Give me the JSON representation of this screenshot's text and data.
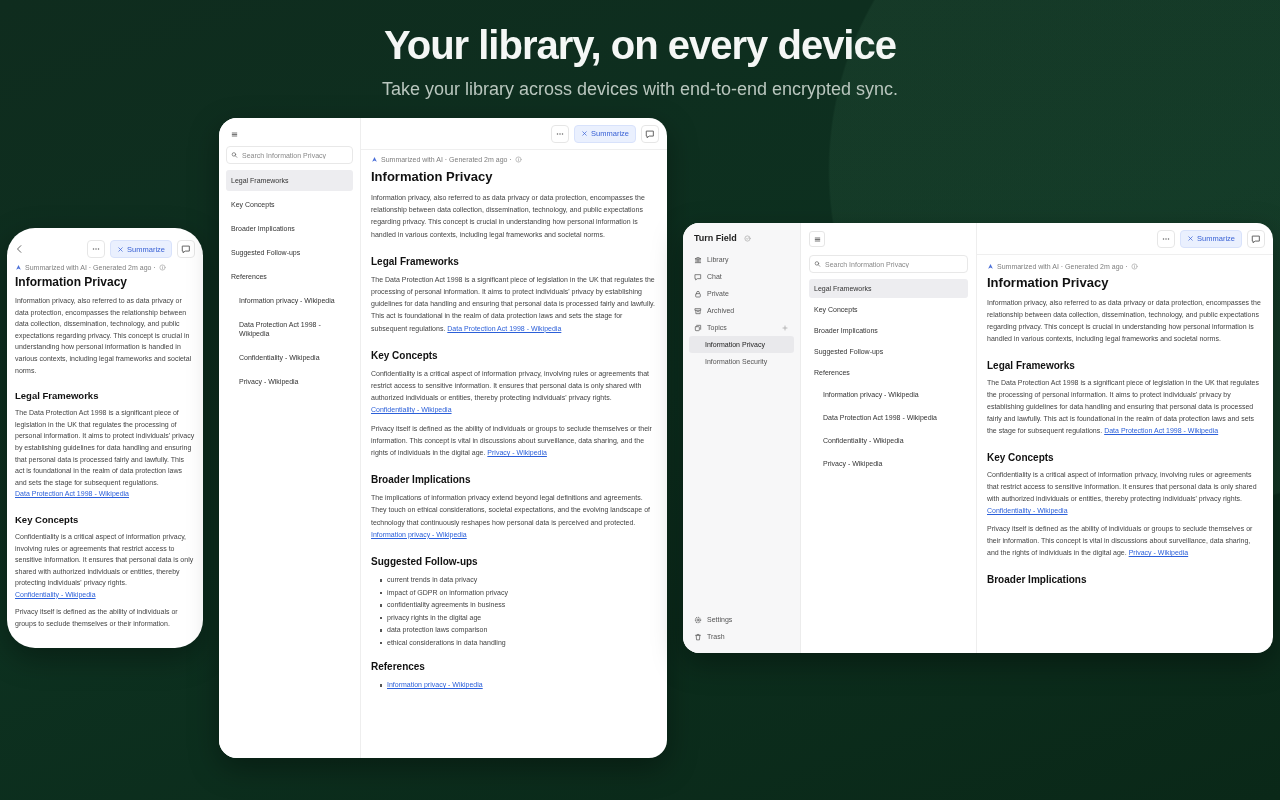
{
  "hero": {
    "title": "Your library, on every device",
    "subtitle": "Take your library across devices with end-to-end encrypted sync."
  },
  "devices": [
    {
      "kind": "phone",
      "main": {
        "toolbar": {
          "summarize": "Summarize"
        },
        "meta": "Summarized with AI · Generated 2m ago ·",
        "article": [
          {
            "kind": "title",
            "text": "Information Privacy"
          },
          {
            "kind": "paragraph",
            "text": "Information privacy, also referred to as data privacy or data protection, encompasses the relationship between data collection, dissemination, technology, and public expectations regarding privacy. This concept is crucial in understanding how personal information is handled in various contexts, including legal frameworks and societal norms."
          },
          {
            "kind": "heading",
            "text": "Legal Frameworks"
          },
          {
            "kind": "paragraph",
            "text": "The Data Protection Act 1998 is a significant piece of legislation in the UK that regulates the processing of personal information. It aims to protect individuals' privacy by establishing guidelines for data handling and ensuring that personal data is processed fairly and lawfully. This act is foundational in the realm of data protection laws and sets the stage for subsequent regulations.",
            "link": "Data Protection Act 1998 - Wikipedia"
          },
          {
            "kind": "heading",
            "text": "Key Concepts"
          },
          {
            "kind": "paragraph",
            "text": "Confidentiality is a critical aspect of information privacy, involving rules or agreements that restrict access to sensitive information. It ensures that personal data is only shared with authorized individuals or entities, thereby protecting individuals' privacy rights.",
            "link": "Confidentiality - Wikipedia"
          },
          {
            "kind": "paragraph",
            "text": "Privacy itself is defined as the ability of individuals or groups to seclude themselves or their information."
          }
        ]
      }
    },
    {
      "kind": "tablet",
      "outline_panel": {
        "search": {
          "placeholder": "Search Information Privacy"
        },
        "outline": [
          {
            "label": "Legal Frameworks",
            "selected": true
          },
          {
            "label": "Key Concepts",
            "selected": false
          },
          {
            "label": "Broader Implications",
            "selected": false
          },
          {
            "label": "Suggested Follow-ups",
            "selected": false
          },
          {
            "label": "References",
            "selected": false,
            "children": [
              {
                "label": "Information privacy - Wikipedia",
                "selected": false
              },
              {
                "label": "Data Protection Act 1998 - Wikipedia",
                "selected": false
              },
              {
                "label": "Confidentiality - Wikipedia",
                "selected": false
              },
              {
                "label": "Privacy - Wikipedia",
                "selected": false
              }
            ]
          }
        ]
      },
      "main": {
        "toolbar": {
          "summarize": "Summarize"
        },
        "meta": "Summarized with AI · Generated 2m ago ·",
        "article": [
          {
            "kind": "title",
            "text": "Information Privacy"
          },
          {
            "kind": "paragraph",
            "text": "Information privacy, also referred to as data privacy or data protection, encompasses the relationship between data collection, dissemination, technology, and public expectations regarding privacy. This concept is crucial in understanding how personal information is handled in various contexts, including legal frameworks and societal norms."
          },
          {
            "kind": "heading",
            "text": "Legal Frameworks"
          },
          {
            "kind": "paragraph",
            "text": "The Data Protection Act 1998 is a significant piece of legislation in the UK that regulates the processing of personal information. It aims to protect individuals' privacy by establishing guidelines for data handling and ensuring that personal data is processed fairly and lawfully. This act is foundational in the realm of data protection laws and sets the stage for subsequent regulations.",
            "link": "Data Protection Act 1998 - Wikipedia"
          },
          {
            "kind": "heading",
            "text": "Key Concepts"
          },
          {
            "kind": "paragraph",
            "text": "Confidentiality is a critical aspect of information privacy, involving rules or agreements that restrict access to sensitive information. It ensures that personal data is only shared with authorized individuals or entities, thereby protecting individuals' privacy rights.",
            "link": "Confidentiality - Wikipedia"
          },
          {
            "kind": "paragraph",
            "text": "Privacy itself is defined as the ability of individuals or groups to seclude themselves or their information. This concept is vital in discussions about surveillance, data sharing, and the rights of individuals in the digital age.",
            "link": "Privacy - Wikipedia"
          },
          {
            "kind": "heading",
            "text": "Broader Implications"
          },
          {
            "kind": "paragraph",
            "text": "The implications of information privacy extend beyond legal definitions and agreements. They touch on ethical considerations, societal expectations, and the evolving landscape of technology that continuously reshapes how personal data is perceived and protected.",
            "link": "Information privacy - Wikipedia"
          },
          {
            "kind": "heading",
            "text": "Suggested Follow-ups"
          },
          {
            "kind": "bullets",
            "items": [
              "current trends in data privacy",
              "impact of GDPR on information privacy",
              "confidentiality agreements in business",
              "privacy rights in the digital age",
              "data protection laws comparison",
              "ethical considerations in data handling"
            ]
          },
          {
            "kind": "heading",
            "text": "References"
          },
          {
            "kind": "links",
            "items": [
              "Information privacy - Wikipedia"
            ]
          }
        ]
      }
    },
    {
      "kind": "desktop",
      "nav_sidebar": {
        "app_name": "Turn Field",
        "nav": [
          {
            "label": "Library"
          },
          {
            "label": "Chat"
          },
          {
            "label": "Private"
          },
          {
            "label": "Archived"
          },
          {
            "label": "Topics",
            "children": [
              {
                "label": "Information Privacy",
                "selected": true
              },
              {
                "label": "Information Security",
                "selected": false
              }
            ]
          }
        ],
        "footer": [
          {
            "label": "Settings"
          },
          {
            "label": "Trash"
          }
        ]
      },
      "outline_panel": {
        "search": {
          "placeholder": "Search Information Privacy"
        },
        "outline": [
          {
            "label": "Legal Frameworks",
            "selected": true
          },
          {
            "label": "Key Concepts",
            "selected": false
          },
          {
            "label": "Broader Implications",
            "selected": false
          },
          {
            "label": "Suggested Follow-ups",
            "selected": false
          },
          {
            "label": "References",
            "selected": false,
            "children": [
              {
                "label": "Information privacy - Wikipedia",
                "selected": false
              },
              {
                "label": "Data Protection Act 1998 - Wikipedia",
                "selected": false
              },
              {
                "label": "Confidentiality - Wikipedia",
                "selected": false
              },
              {
                "label": "Privacy - Wikipedia",
                "selected": false
              }
            ]
          }
        ]
      },
      "main": {
        "toolbar": {
          "summarize": "Summarize"
        },
        "meta": "Summarized with AI · Generated 2m ago ·",
        "article": [
          {
            "kind": "title",
            "text": "Information Privacy"
          },
          {
            "kind": "paragraph",
            "text": "Information privacy, also referred to as data privacy or data protection, encompasses the relationship between data collection, dissemination, technology, and public expectations regarding privacy. This concept is crucial in understanding how personal information is handled in various contexts, including legal frameworks and societal norms."
          },
          {
            "kind": "heading",
            "text": "Legal Frameworks"
          },
          {
            "kind": "paragraph",
            "text": "The Data Protection Act 1998 is a significant piece of legislation in the UK that regulates the processing of personal information. It aims to protect individuals' privacy by establishing guidelines for data handling and ensuring that personal data is processed fairly and lawfully. This act is foundational in the realm of data protection laws and sets the stage for subsequent regulations.",
            "link": "Data Protection Act 1998 - Wikipedia"
          },
          {
            "kind": "heading",
            "text": "Key Concepts"
          },
          {
            "kind": "paragraph",
            "text": "Confidentiality is a critical aspect of information privacy, involving rules or agreements that restrict access to sensitive information. It ensures that personal data is only shared with authorized individuals or entities, thereby protecting individuals' privacy rights.",
            "link": "Confidentiality - Wikipedia"
          },
          {
            "kind": "paragraph",
            "text": "Privacy itself is defined as the ability of individuals or groups to seclude themselves or their information. This concept is vital in discussions about surveillance, data sharing, and the rights of individuals in the digital age.",
            "link": "Privacy - Wikipedia"
          },
          {
            "kind": "heading",
            "text": "Broader Implications"
          }
        ]
      }
    }
  ]
}
